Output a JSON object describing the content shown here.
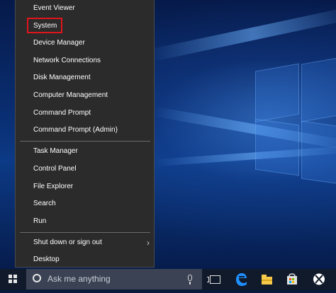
{
  "menu": {
    "groups": [
      [
        "Event Viewer",
        "System",
        "Device Manager",
        "Network Connections",
        "Disk Management",
        "Computer Management",
        "Command Prompt",
        "Command Prompt (Admin)"
      ],
      [
        "Task Manager",
        "Control Panel",
        "File Explorer",
        "Search",
        "Run"
      ],
      [
        "Shut down or sign out",
        "Desktop"
      ]
    ],
    "highlighted_item": "System",
    "highlight_color": "#e0141c"
  },
  "taskbar": {
    "search_placeholder": "Ask me anything",
    "icons": [
      "windows-start-icon",
      "cortana-icon",
      "microphone-icon",
      "task-view-icon",
      "edge-icon",
      "file-explorer-icon",
      "store-icon",
      "xbox-icon"
    ]
  },
  "colors": {
    "menu_bg": "#2b2b2b",
    "taskbar_bg": "#101a2a",
    "edge_blue": "#1e90ff",
    "folder_yellow": "#f6c94a",
    "xbox_white": "#ffffff"
  }
}
